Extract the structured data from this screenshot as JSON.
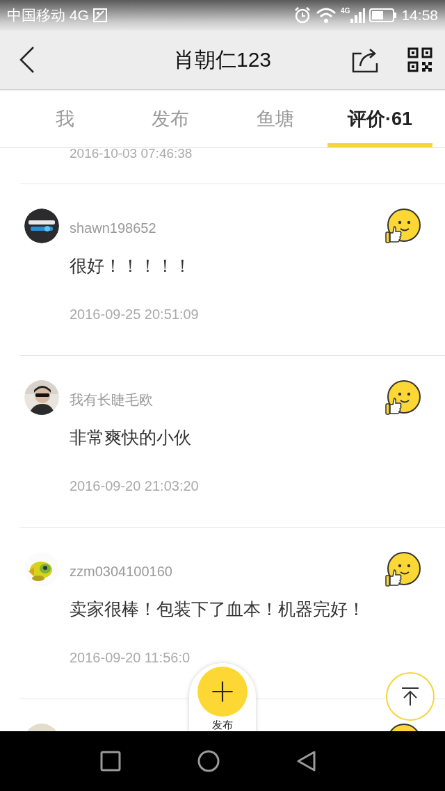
{
  "status_bar": {
    "carrier": "中国移动 4G",
    "signal_label": "4G",
    "time": "14:58"
  },
  "header": {
    "title": "肖朝仁123"
  },
  "tabs": [
    {
      "label": "我",
      "selected": false
    },
    {
      "label": "发布",
      "selected": false
    },
    {
      "label": "鱼塘",
      "selected": false
    },
    {
      "label": "评价·61",
      "selected": true
    }
  ],
  "previous_date": "2016-10-03 07:46:38",
  "reviews": [
    {
      "avatar": {
        "kind": "picture"
      },
      "name": "shawn198652",
      "comment": "很好！！！！！",
      "date": "2016-09-25 20:51:09"
    },
    {
      "avatar": {
        "kind": "picture"
      },
      "name": "我有长睫毛欧",
      "comment": "非常爽快的小伙",
      "date": "2016-09-20 21:03:20"
    },
    {
      "avatar": {
        "kind": "picture"
      },
      "name": "zzm0304100160",
      "comment": "卖家很棒！包装下了血本！机器完好！",
      "date": "2016-09-20 11:56:0"
    },
    {
      "avatar": {
        "kind": "picture"
      }
    }
  ],
  "publish_button": {
    "label": "发布"
  }
}
